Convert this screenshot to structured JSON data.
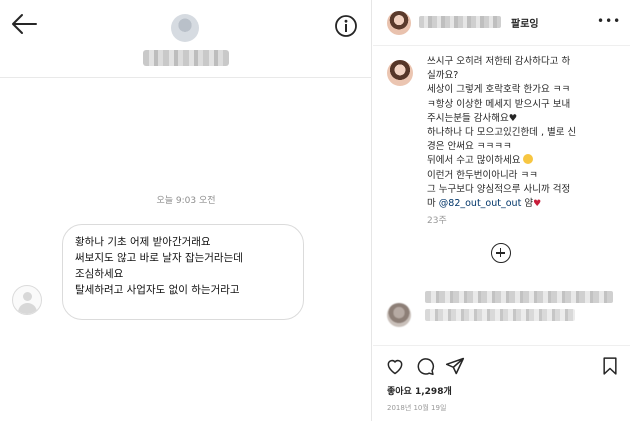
{
  "dm": {
    "timestamp": "오늘 9:03 오전",
    "message_lines": [
      "황하나 기초 어제 받아간거래요",
      "써보지도 않고 바로 날자 잡는거라는데",
      "조심하세요",
      "탈세하려고 사업자도 없이 하는거라고"
    ],
    "icons": {
      "back": "back-arrow-icon",
      "info": "info-icon",
      "avatar": "default-avatar-icon"
    }
  },
  "post": {
    "follow_label": "팔로잉",
    "more_icon": "•••",
    "comment_lines": [
      "쓰시구 오히려 저한테 감사하다고 하",
      "실까요?",
      "세상이 그렇게 호락호락 한가요 ㅋㅋ",
      "ㅋ항상 이상한 메세지 받으시구 보내",
      "주시는분들 감사해요♥",
      "하나하나 다 모으고있긴한데 , 별로 신",
      "경은 안써요 ㅋㅋㅋㅋ",
      "뒤에서 수고 많이하세요",
      "이런거 한두번이아니라 ㅋㅋ",
      "그 누구보다 양심적으루 사니까 걱정",
      "마"
    ],
    "mention": "@82_out_out_out",
    "mention_suffix": "얌",
    "comment_age": "23주",
    "likes_label": "좋아요",
    "likes_count": "1,298개",
    "date": "2018년 10월 19일",
    "icons": [
      "heart-icon",
      "comment-icon",
      "share-icon",
      "bookmark-icon",
      "load-more-icon"
    ]
  }
}
